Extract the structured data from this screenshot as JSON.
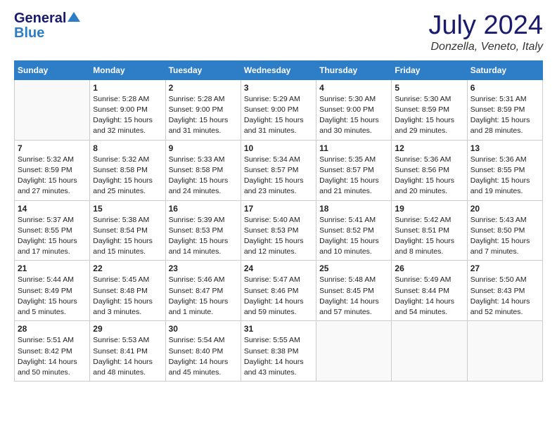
{
  "header": {
    "logo_general": "General",
    "logo_blue": "Blue",
    "month_title": "July 2024",
    "location": "Donzella, Veneto, Italy"
  },
  "days_of_week": [
    "Sunday",
    "Monday",
    "Tuesday",
    "Wednesday",
    "Thursday",
    "Friday",
    "Saturday"
  ],
  "weeks": [
    [
      {
        "day": "",
        "info": ""
      },
      {
        "day": "1",
        "info": "Sunrise: 5:28 AM\nSunset: 9:00 PM\nDaylight: 15 hours\nand 32 minutes."
      },
      {
        "day": "2",
        "info": "Sunrise: 5:28 AM\nSunset: 9:00 PM\nDaylight: 15 hours\nand 31 minutes."
      },
      {
        "day": "3",
        "info": "Sunrise: 5:29 AM\nSunset: 9:00 PM\nDaylight: 15 hours\nand 31 minutes."
      },
      {
        "day": "4",
        "info": "Sunrise: 5:30 AM\nSunset: 9:00 PM\nDaylight: 15 hours\nand 30 minutes."
      },
      {
        "day": "5",
        "info": "Sunrise: 5:30 AM\nSunset: 8:59 PM\nDaylight: 15 hours\nand 29 minutes."
      },
      {
        "day": "6",
        "info": "Sunrise: 5:31 AM\nSunset: 8:59 PM\nDaylight: 15 hours\nand 28 minutes."
      }
    ],
    [
      {
        "day": "7",
        "info": "Sunrise: 5:32 AM\nSunset: 8:59 PM\nDaylight: 15 hours\nand 27 minutes."
      },
      {
        "day": "8",
        "info": "Sunrise: 5:32 AM\nSunset: 8:58 PM\nDaylight: 15 hours\nand 25 minutes."
      },
      {
        "day": "9",
        "info": "Sunrise: 5:33 AM\nSunset: 8:58 PM\nDaylight: 15 hours\nand 24 minutes."
      },
      {
        "day": "10",
        "info": "Sunrise: 5:34 AM\nSunset: 8:57 PM\nDaylight: 15 hours\nand 23 minutes."
      },
      {
        "day": "11",
        "info": "Sunrise: 5:35 AM\nSunset: 8:57 PM\nDaylight: 15 hours\nand 21 minutes."
      },
      {
        "day": "12",
        "info": "Sunrise: 5:36 AM\nSunset: 8:56 PM\nDaylight: 15 hours\nand 20 minutes."
      },
      {
        "day": "13",
        "info": "Sunrise: 5:36 AM\nSunset: 8:55 PM\nDaylight: 15 hours\nand 19 minutes."
      }
    ],
    [
      {
        "day": "14",
        "info": "Sunrise: 5:37 AM\nSunset: 8:55 PM\nDaylight: 15 hours\nand 17 minutes."
      },
      {
        "day": "15",
        "info": "Sunrise: 5:38 AM\nSunset: 8:54 PM\nDaylight: 15 hours\nand 15 minutes."
      },
      {
        "day": "16",
        "info": "Sunrise: 5:39 AM\nSunset: 8:53 PM\nDaylight: 15 hours\nand 14 minutes."
      },
      {
        "day": "17",
        "info": "Sunrise: 5:40 AM\nSunset: 8:53 PM\nDaylight: 15 hours\nand 12 minutes."
      },
      {
        "day": "18",
        "info": "Sunrise: 5:41 AM\nSunset: 8:52 PM\nDaylight: 15 hours\nand 10 minutes."
      },
      {
        "day": "19",
        "info": "Sunrise: 5:42 AM\nSunset: 8:51 PM\nDaylight: 15 hours\nand 8 minutes."
      },
      {
        "day": "20",
        "info": "Sunrise: 5:43 AM\nSunset: 8:50 PM\nDaylight: 15 hours\nand 7 minutes."
      }
    ],
    [
      {
        "day": "21",
        "info": "Sunrise: 5:44 AM\nSunset: 8:49 PM\nDaylight: 15 hours\nand 5 minutes."
      },
      {
        "day": "22",
        "info": "Sunrise: 5:45 AM\nSunset: 8:48 PM\nDaylight: 15 hours\nand 3 minutes."
      },
      {
        "day": "23",
        "info": "Sunrise: 5:46 AM\nSunset: 8:47 PM\nDaylight: 15 hours\nand 1 minute."
      },
      {
        "day": "24",
        "info": "Sunrise: 5:47 AM\nSunset: 8:46 PM\nDaylight: 14 hours\nand 59 minutes."
      },
      {
        "day": "25",
        "info": "Sunrise: 5:48 AM\nSunset: 8:45 PM\nDaylight: 14 hours\nand 57 minutes."
      },
      {
        "day": "26",
        "info": "Sunrise: 5:49 AM\nSunset: 8:44 PM\nDaylight: 14 hours\nand 54 minutes."
      },
      {
        "day": "27",
        "info": "Sunrise: 5:50 AM\nSunset: 8:43 PM\nDaylight: 14 hours\nand 52 minutes."
      }
    ],
    [
      {
        "day": "28",
        "info": "Sunrise: 5:51 AM\nSunset: 8:42 PM\nDaylight: 14 hours\nand 50 minutes."
      },
      {
        "day": "29",
        "info": "Sunrise: 5:53 AM\nSunset: 8:41 PM\nDaylight: 14 hours\nand 48 minutes."
      },
      {
        "day": "30",
        "info": "Sunrise: 5:54 AM\nSunset: 8:40 PM\nDaylight: 14 hours\nand 45 minutes."
      },
      {
        "day": "31",
        "info": "Sunrise: 5:55 AM\nSunset: 8:38 PM\nDaylight: 14 hours\nand 43 minutes."
      },
      {
        "day": "",
        "info": ""
      },
      {
        "day": "",
        "info": ""
      },
      {
        "day": "",
        "info": ""
      }
    ]
  ]
}
